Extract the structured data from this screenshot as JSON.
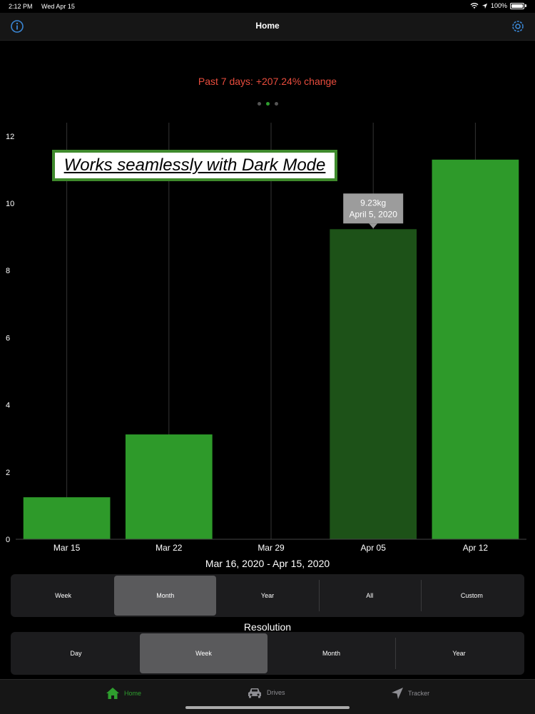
{
  "status_bar": {
    "time": "2:12 PM",
    "date": "Wed Apr 15",
    "battery": "100%"
  },
  "nav": {
    "title": "Home",
    "left_icon": "info-icon",
    "right_icon": "gear-icon"
  },
  "summary": {
    "change_text": "Past 7 days: +207.24% change"
  },
  "pager": {
    "count": 3,
    "active_index": 1
  },
  "banner": {
    "text": "Works seamlessly with Dark Mode"
  },
  "chart_data": {
    "type": "bar",
    "categories": [
      "Mar 15",
      "Mar 22",
      "Mar 29",
      "Apr 05",
      "Apr 12"
    ],
    "values": [
      1.25,
      3.12,
      0,
      9.23,
      11.3
    ],
    "yticks": [
      0,
      2,
      4,
      6,
      8,
      10,
      12
    ],
    "ylim": [
      0,
      12.4
    ],
    "grid": "vertical lines at category centers",
    "selected_index": 3,
    "tooltip": {
      "value": "9.23kg",
      "date": "April 5, 2020"
    },
    "colors": {
      "bar": "#2e9a2a",
      "bar_selected": "#1d5218",
      "grid": "#333333",
      "axis_text": "#ffffff",
      "tooltip_bg": "#9c9c9c"
    }
  },
  "range_label": "Mar 16, 2020 - Apr 15, 2020",
  "period_options": {
    "items": [
      "Week",
      "Month",
      "Year",
      "All",
      "Custom"
    ],
    "selected": "Month"
  },
  "resolution": {
    "label": "Resolution",
    "items": [
      "Day",
      "Week",
      "Month",
      "Year"
    ],
    "selected": "Week"
  },
  "tabs": [
    {
      "label": "Home",
      "icon": "house-icon",
      "active": true
    },
    {
      "label": "Drives",
      "icon": "car-icon",
      "active": false
    },
    {
      "label": "Tracker",
      "icon": "location-arrow-icon",
      "active": false
    }
  ],
  "colors": {
    "accent_green": "#2e9e2e",
    "change_red": "#e84c3d",
    "link_blue": "#3a86d4"
  }
}
